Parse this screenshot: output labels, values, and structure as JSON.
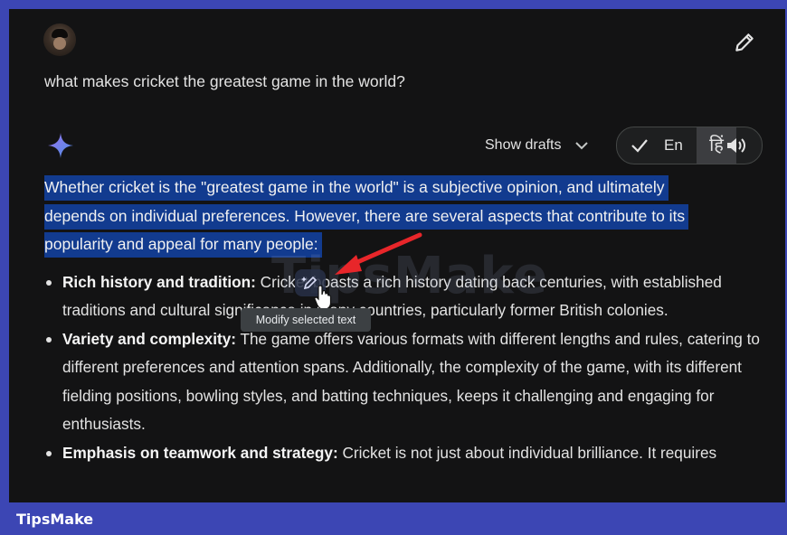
{
  "prompt": "what makes cricket the greatest game in the world?",
  "header": {
    "show_drafts_label": "Show drafts",
    "language_current": "En",
    "language_alt": "हिं"
  },
  "response": {
    "intro_line_1": "Whether cricket is the \"greatest game in the world\" is a subjective opinion, and ultimately",
    "intro_line_2": "depends on individual preferences. However, there are several aspects that contribute to its",
    "intro_line_3": "popularity and appeal for many people:",
    "points": [
      {
        "title": "Rich history and tradition:",
        "text": " Cricket boasts a rich history dating back centuries, with established traditions and cultural significance in many countries, particularly former British colonies."
      },
      {
        "title": "Variety and complexity:",
        "text": " The game offers various formats with different lengths and rules, catering to different preferences and attention spans. Additionally, the complexity of the game, with its different fielding positions, bowling styles, and batting techniques, keeps it challenging and engaging for enthusiasts."
      },
      {
        "title": "Emphasis on teamwork and strategy:",
        "text": " Cricket is not just about individual brilliance. It requires"
      }
    ]
  },
  "tooltip": "Modify selected text",
  "watermark": "TipsMake",
  "footer_brand": "TipsMake",
  "colors": {
    "background": "#131314",
    "selection": "#123b8f",
    "frame": "#3c46b4",
    "arrow": "#e8262a",
    "spark": "#4a90e2"
  },
  "icons": [
    "avatar",
    "pencil-icon",
    "sparkle-icon",
    "chevron-down-icon",
    "check-icon",
    "speaker-icon",
    "modify-pencil-icon",
    "hand-cursor-icon",
    "red-arrow"
  ]
}
